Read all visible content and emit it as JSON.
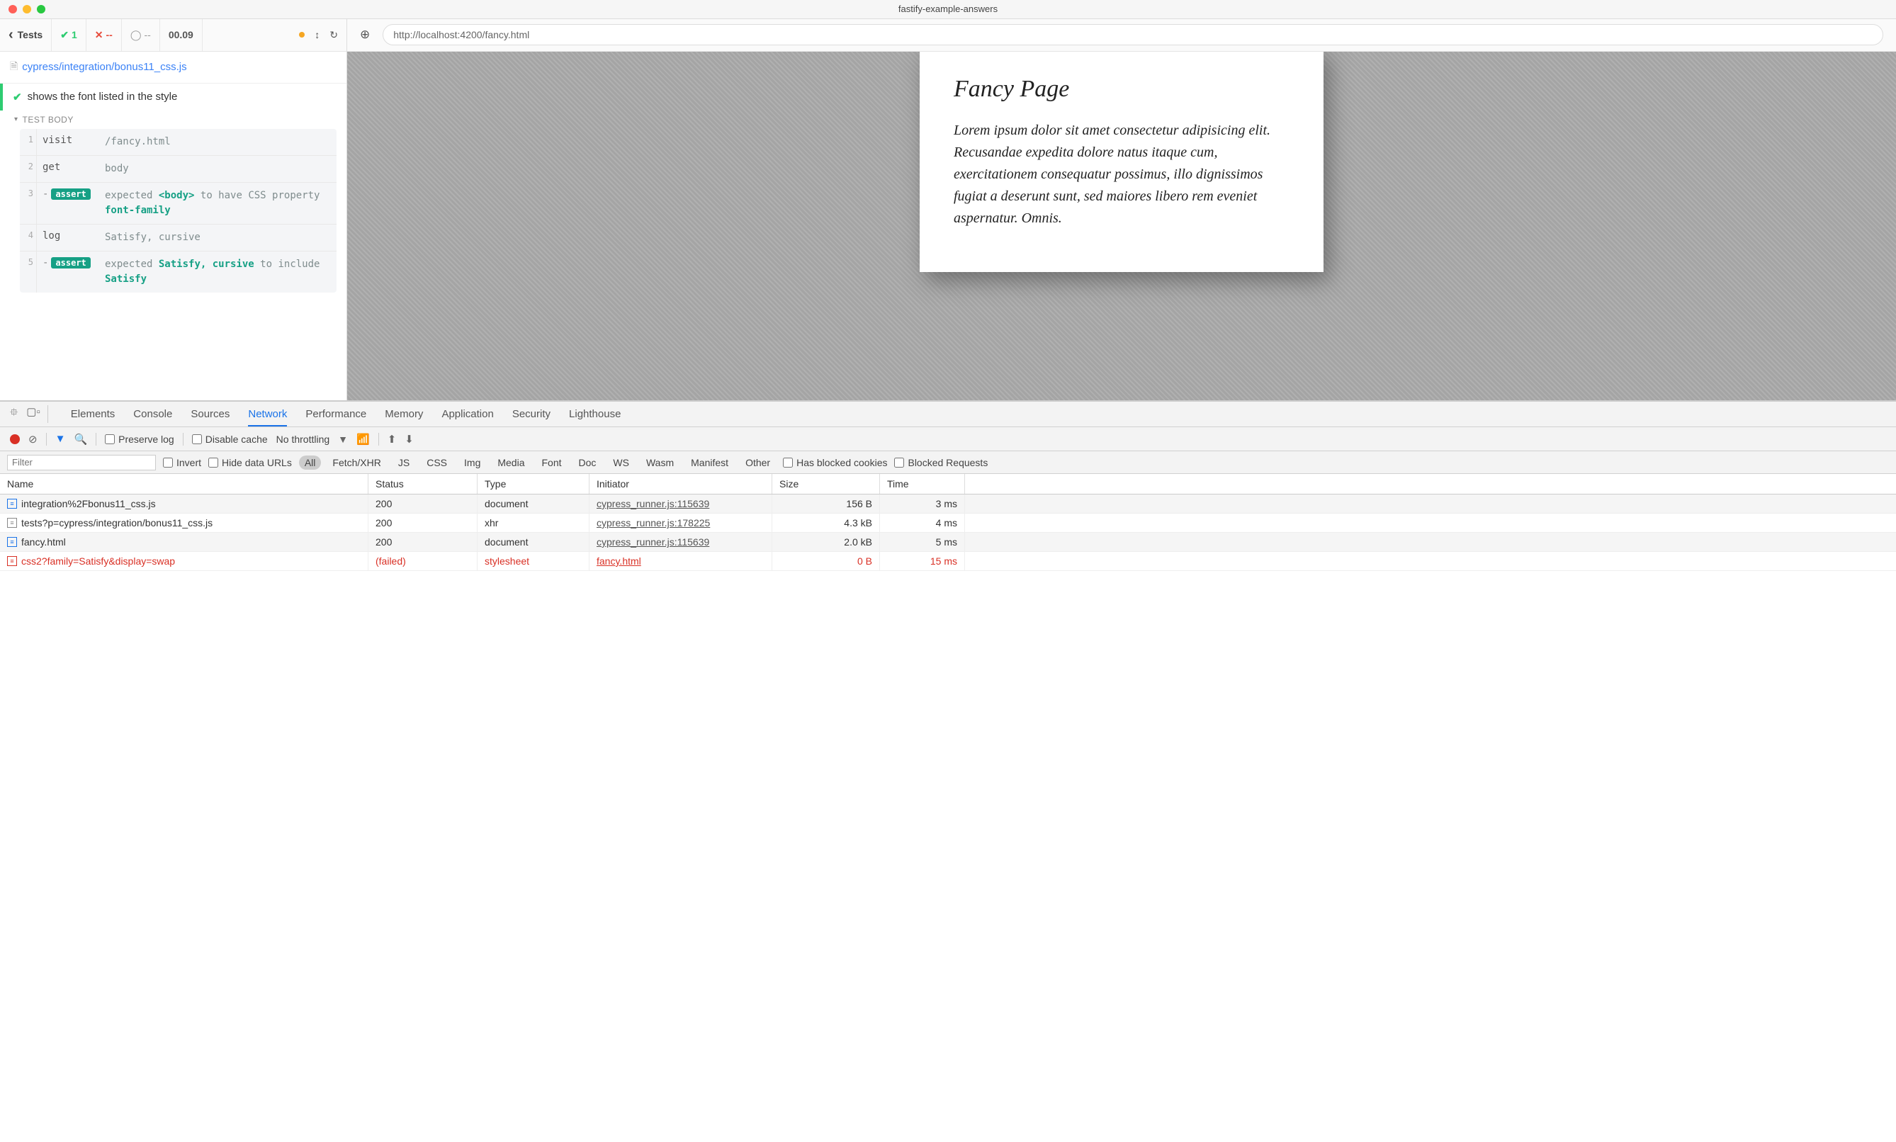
{
  "window": {
    "title": "fastify-example-answers"
  },
  "cypress": {
    "tests_label": "Tests",
    "pass_count": "1",
    "fail_count": "--",
    "pending_count": "--",
    "duration": "00.09",
    "spec_file": "cypress/integration/bonus11_css.js",
    "test_name": "shows the font listed in the style",
    "test_body_label": "TEST BODY",
    "commands": [
      {
        "num": "1",
        "name": "visit",
        "msg_html": "<span class='msg-grey'>/fancy.html</span>"
      },
      {
        "num": "2",
        "name": "get",
        "msg_html": "<span class='msg-grey'>body</span>"
      },
      {
        "num": "3",
        "name": "<span class='dash'>-</span><span class='assert-badge'>assert</span>",
        "msg_html": "<span class='msg-grey'>expected</span> <span class='msg-teal'>&lt;body&gt;</span> <span class='msg-grey'>to have CSS property</span> <span class='msg-teal'>font-family</span>"
      },
      {
        "num": "4",
        "name": "log",
        "msg_html": "<span class='msg-grey'>Satisfy, cursive</span>"
      },
      {
        "num": "5",
        "name": "<span class='dash'>-</span><span class='assert-badge'>assert</span>",
        "msg_html": "<span class='msg-grey'>expected</span> <span class='msg-teal'>Satisfy, cursive</span> <span class='msg-grey'>to include</span> <span class='msg-teal'>Satisfy</span>"
      }
    ]
  },
  "preview": {
    "url": "http://localhost:4200/fancy.html",
    "page_title": "Fancy Page",
    "page_body": "Lorem ipsum dolor sit amet consectetur adipisicing elit. Recusandae expedita dolore natus itaque cum, exercitationem consequatur possimus, illo dignissimos fugiat a deserunt sunt, sed maiores libero rem eveniet aspernatur. Omnis."
  },
  "devtools": {
    "tabs": [
      "Elements",
      "Console",
      "Sources",
      "Network",
      "Performance",
      "Memory",
      "Application",
      "Security",
      "Lighthouse"
    ],
    "active_tab": "Network",
    "preserve_log": "Preserve log",
    "disable_cache": "Disable cache",
    "throttling": "No throttling",
    "filter_placeholder": "Filter",
    "invert": "Invert",
    "hide_data_urls": "Hide data URLs",
    "type_filters": [
      "All",
      "Fetch/XHR",
      "JS",
      "CSS",
      "Img",
      "Media",
      "Font",
      "Doc",
      "WS",
      "Wasm",
      "Manifest",
      "Other"
    ],
    "has_blocked_cookies": "Has blocked cookies",
    "blocked_requests": "Blocked Requests",
    "columns": {
      "name": "Name",
      "status": "Status",
      "type": "Type",
      "initiator": "Initiator",
      "size": "Size",
      "time": "Time"
    },
    "rows": [
      {
        "icon": "blue",
        "name": "integration%2Fbonus11_css.js",
        "status": "200",
        "type": "document",
        "initiator": "cypress_runner.js:115639",
        "size": "156 B",
        "time": "3 ms",
        "failed": false
      },
      {
        "icon": "grey",
        "name": "tests?p=cypress/integration/bonus11_css.js",
        "status": "200",
        "type": "xhr",
        "initiator": "cypress_runner.js:178225",
        "size": "4.3 kB",
        "time": "4 ms",
        "failed": false
      },
      {
        "icon": "blue",
        "name": "fancy.html",
        "status": "200",
        "type": "document",
        "initiator": "cypress_runner.js:115639",
        "size": "2.0 kB",
        "time": "5 ms",
        "failed": false
      },
      {
        "icon": "red",
        "name": "css2?family=Satisfy&display=swap",
        "status": "(failed)",
        "type": "stylesheet",
        "initiator": "fancy.html",
        "size": "0 B",
        "time": "15 ms",
        "failed": true
      }
    ]
  }
}
